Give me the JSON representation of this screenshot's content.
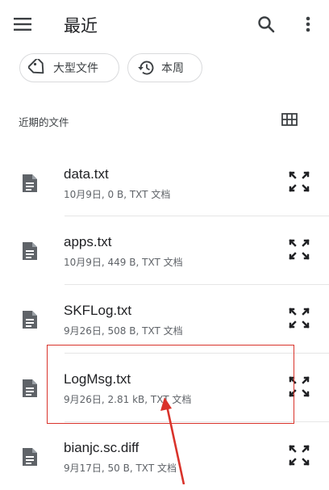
{
  "app_bar": {
    "title": "最近",
    "menu_icon": "hamburger-menu-icon",
    "search_icon": "search-icon",
    "more_icon": "more-vert-icon"
  },
  "chips": [
    {
      "label": "大型文件",
      "icon": "tag-icon"
    },
    {
      "label": "本周",
      "icon": "history-icon"
    }
  ],
  "section": {
    "label": "近期的文件",
    "view_toggle_icon": "grid-view-icon"
  },
  "files": [
    {
      "name": "data.txt",
      "meta": "10月9日, 0 B, TXT 文档"
    },
    {
      "name": "apps.txt",
      "meta": "10月9日, 449 B, TXT 文档"
    },
    {
      "name": "SKFLog.txt",
      "meta": "9月26日, 508 B, TXT 文档"
    },
    {
      "name": "LogMsg.txt",
      "meta": "9月26日, 2.81 kB, TXT 文档"
    },
    {
      "name": "bianjc.sc.diff",
      "meta": "9月17日, 50 B, TXT 文档"
    }
  ],
  "annotation": {
    "highlight_color": "#d9332b",
    "highlighted_file": "LogMsg.txt"
  }
}
